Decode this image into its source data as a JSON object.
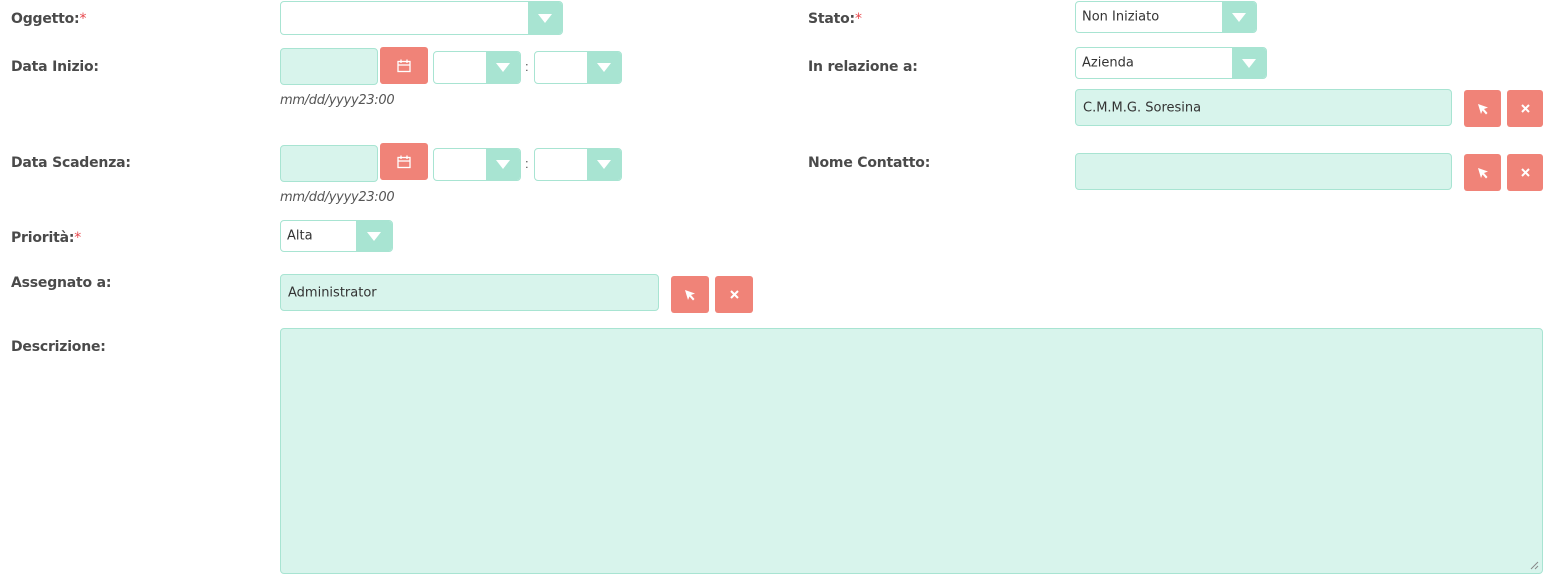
{
  "labels": {
    "oggetto": "Oggetto:",
    "data_inizio": "Data Inizio:",
    "data_scadenza": "Data Scadenza:",
    "priorita": "Priorità:",
    "assegnato": "Assegnato a:",
    "descrizione": "Descrizione:",
    "stato": "Stato:",
    "in_relazione": "In relazione a:",
    "nome_contatto": "Nome Contatto:"
  },
  "required_mark": "*",
  "fields": {
    "oggetto_value": "",
    "data_inizio_value": "",
    "data_inizio_hour": "",
    "data_inizio_minute": "",
    "data_inizio_hint": "mm/dd/yyyy23:00",
    "data_scadenza_value": "",
    "data_scadenza_hour": "",
    "data_scadenza_minute": "",
    "data_scadenza_hint": "mm/dd/yyyy23:00",
    "priorita_value": "Alta",
    "assegnato_value": "Administrator",
    "descrizione_value": "",
    "stato_value": "Non Iniziato",
    "in_relazione_type": "Azienda",
    "in_relazione_value": "C.M.M.G. Soresina",
    "nome_contatto_value": ""
  },
  "time_separator": ":",
  "icons": {
    "calendar": "calendar-icon",
    "select": "cursor-arrow-icon",
    "clear": "close-icon",
    "dropdown": "triangle-down-icon"
  },
  "colors": {
    "field_bg": "#d8f4ec",
    "field_border": "#a8e4d2",
    "dropdown_arrow_bg": "#a8e4d2",
    "action_button": "#f08378",
    "required": "#e8474c"
  }
}
